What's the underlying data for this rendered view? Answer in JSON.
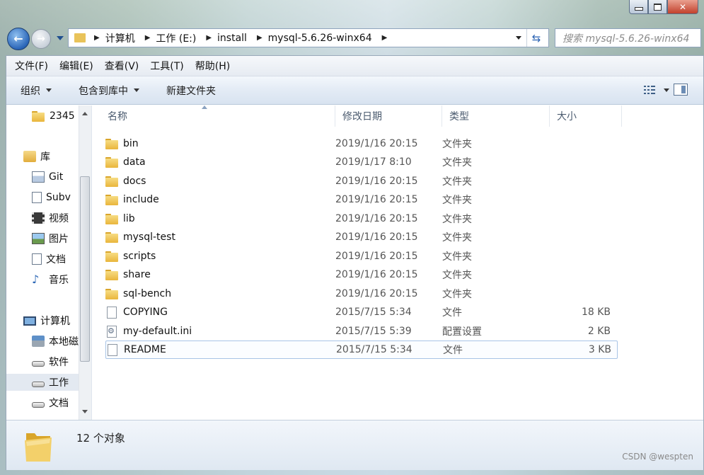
{
  "window": {
    "caption_buttons": [
      "minimize",
      "maximize",
      "close"
    ]
  },
  "navbar": {
    "breadcrumb": [
      "计算机",
      "工作 (E:)",
      "install",
      "mysql-5.6.26-winx64"
    ],
    "search_placeholder": "搜索 mysql-5.6.26-winx64"
  },
  "menubar": {
    "items": [
      "文件(F)",
      "编辑(E)",
      "查看(V)",
      "工具(T)",
      "帮助(H)"
    ]
  },
  "toolbar": {
    "organize": "组织",
    "include_in_library": "包含到库中",
    "new_folder": "新建文件夹"
  },
  "navpane": {
    "items": [
      {
        "label": "2345",
        "icon": "folder-icon"
      },
      {
        "label": "库",
        "icon": "library-icon"
      },
      {
        "label": "Git",
        "icon": "git-icon"
      },
      {
        "label": "Subv",
        "icon": "document-icon"
      },
      {
        "label": "视频",
        "icon": "video-icon"
      },
      {
        "label": "图片",
        "icon": "picture-icon"
      },
      {
        "label": "文档",
        "icon": "document-icon"
      },
      {
        "label": "音乐",
        "icon": "music-icon"
      },
      {
        "label": "计算机",
        "icon": "computer-icon"
      },
      {
        "label": "本地磁",
        "icon": "local-disk-icon"
      },
      {
        "label": "软件",
        "icon": "drive-icon"
      },
      {
        "label": "工作",
        "icon": "drive-icon"
      },
      {
        "label": "文档",
        "icon": "drive-icon"
      }
    ]
  },
  "filelist": {
    "columns": [
      "名称",
      "修改日期",
      "类型",
      "大小"
    ],
    "rows": [
      {
        "name": "bin",
        "date": "2019/1/16 20:15",
        "type": "文件夹",
        "size": "",
        "icon": "folder-icon"
      },
      {
        "name": "data",
        "date": "2019/1/17 8:10",
        "type": "文件夹",
        "size": "",
        "icon": "folder-icon"
      },
      {
        "name": "docs",
        "date": "2019/1/16 20:15",
        "type": "文件夹",
        "size": "",
        "icon": "folder-icon"
      },
      {
        "name": "include",
        "date": "2019/1/16 20:15",
        "type": "文件夹",
        "size": "",
        "icon": "folder-icon"
      },
      {
        "name": "lib",
        "date": "2019/1/16 20:15",
        "type": "文件夹",
        "size": "",
        "icon": "folder-icon"
      },
      {
        "name": "mysql-test",
        "date": "2019/1/16 20:15",
        "type": "文件夹",
        "size": "",
        "icon": "folder-icon"
      },
      {
        "name": "scripts",
        "date": "2019/1/16 20:15",
        "type": "文件夹",
        "size": "",
        "icon": "folder-icon"
      },
      {
        "name": "share",
        "date": "2019/1/16 20:15",
        "type": "文件夹",
        "size": "",
        "icon": "folder-icon"
      },
      {
        "name": "sql-bench",
        "date": "2019/1/16 20:15",
        "type": "文件夹",
        "size": "",
        "icon": "folder-icon"
      },
      {
        "name": "COPYING",
        "date": "2015/7/15 5:34",
        "type": "文件",
        "size": "18 KB",
        "icon": "file-icon"
      },
      {
        "name": "my-default.ini",
        "date": "2015/7/15 5:39",
        "type": "配置设置",
        "size": "2 KB",
        "icon": "ini-file-icon"
      },
      {
        "name": "README",
        "date": "2015/7/15 5:34",
        "type": "文件",
        "size": "3 KB",
        "icon": "file-icon"
      }
    ]
  },
  "statusbar": {
    "count_text": "12 个对象"
  },
  "watermark": "CSDN @wespten"
}
